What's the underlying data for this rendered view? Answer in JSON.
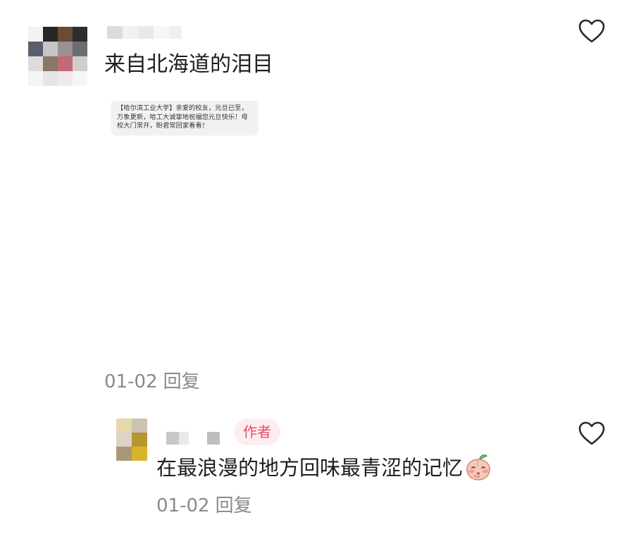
{
  "comment": {
    "avatar_icon": "user-avatar-pixelated",
    "username_icon": "pixelated-username",
    "text": "来自北海道的泪目",
    "attachment": {
      "text": "【哈尔滨工业大学】亲爱的校友，元旦已至，万象更新，哈工大诚挚地祝福您元旦快乐！母校大门常开，盼君常回家看看！"
    },
    "date": "01-02",
    "reply_label": "回复",
    "like_icon": "heart-outline-icon"
  },
  "reply": {
    "avatar_icon": "user-avatar-pixelated",
    "username_icon": "pixelated-username",
    "author_badge": "作者",
    "text": "在最浪漫的地方回味最青涩的记忆",
    "emoji_icon": "peach-blush-emoji-icon",
    "date": "01-02",
    "reply_label": "回复",
    "like_icon": "heart-outline-icon"
  },
  "colors": {
    "author_badge_bg": "#fdeeee",
    "author_badge_text": "#e9496a",
    "meta_text": "#8a8a8a"
  }
}
